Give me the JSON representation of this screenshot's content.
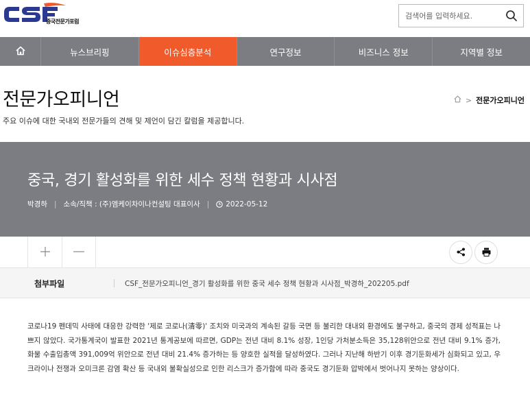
{
  "brand": {
    "logo_text": "CSF",
    "subtitle": "중국전문가포럼",
    "colors": {
      "navy": "#2b3990",
      "orange": "#f15a2b"
    }
  },
  "search": {
    "placeholder": "검색어를 입력하세요.",
    "icon": "search-icon"
  },
  "nav": {
    "home_icon": "home-icon",
    "items": [
      {
        "label": "뉴스브리핑",
        "active": false
      },
      {
        "label": "이슈심층분석",
        "active": true
      },
      {
        "label": "연구정보",
        "active": false
      },
      {
        "label": "비즈니스 정보",
        "active": false
      },
      {
        "label": "지역별 정보",
        "active": false
      }
    ],
    "colors": {
      "bg": "#7b7d82",
      "active": "#f15a2b"
    }
  },
  "page": {
    "title": "전문가오피니언",
    "description": "주요 이슈에 대한 국내외 전문가들의 견해 및 제언이 담긴 칼럼을 제공합니다.",
    "breadcrumb": {
      "home_icon": "home-icon",
      "separator": ">",
      "current": "전문가오피니언"
    }
  },
  "article": {
    "title": "중국, 경기 활성화를 위한 세수 정책 현황과 시사점",
    "author": "박경하",
    "affiliation": "소속/직책 : (주)엠케이차이나컨설팅 대표이사",
    "date": "2022-05-12",
    "clock_icon": "clock-icon"
  },
  "toolbar": {
    "zoom_in": "+",
    "zoom_out": "—",
    "share_icon": "share-icon",
    "print_icon": "print-icon"
  },
  "attachment": {
    "label": "첨부파일",
    "filename": "CSF_전문가오피니언_경기 활성화를 위한 중국 세수 정책 현황과 시사점_박경하_202205.pdf"
  },
  "body": {
    "paragraph": "코로나19 펜데믹 사태에 대응한 강력한 '제로 코로나(清零)' 조치와 미국과의 계속된 갈등 국면 등 불리한 대내외 환경에도 불구하고, 중국의 경제 성적표는 나쁘지 않았다. 국가통계국이 발표한 2021년 통계공보에 따르면, GDP는 전년 대비 8.1% 성장, 1인당 가처분소득은 35,128위안으로 전년 대비 9.1% 증가, 화물 수출입총액 391,009억 위안으로 전년 대비 21.4% 증가하는 등 양호한 실적을 달성하였다. 그러나 지난해 하반기 이후 경기둔화세가 심화되고 있고, 우크라이나 전쟁과 오미크론 감염 확산 등 국내외 불확실성으로 인한 리스크가 증가함에 따라 중국도 경기둔화 압박에서 벗어나지 못하는 양상이다."
  }
}
